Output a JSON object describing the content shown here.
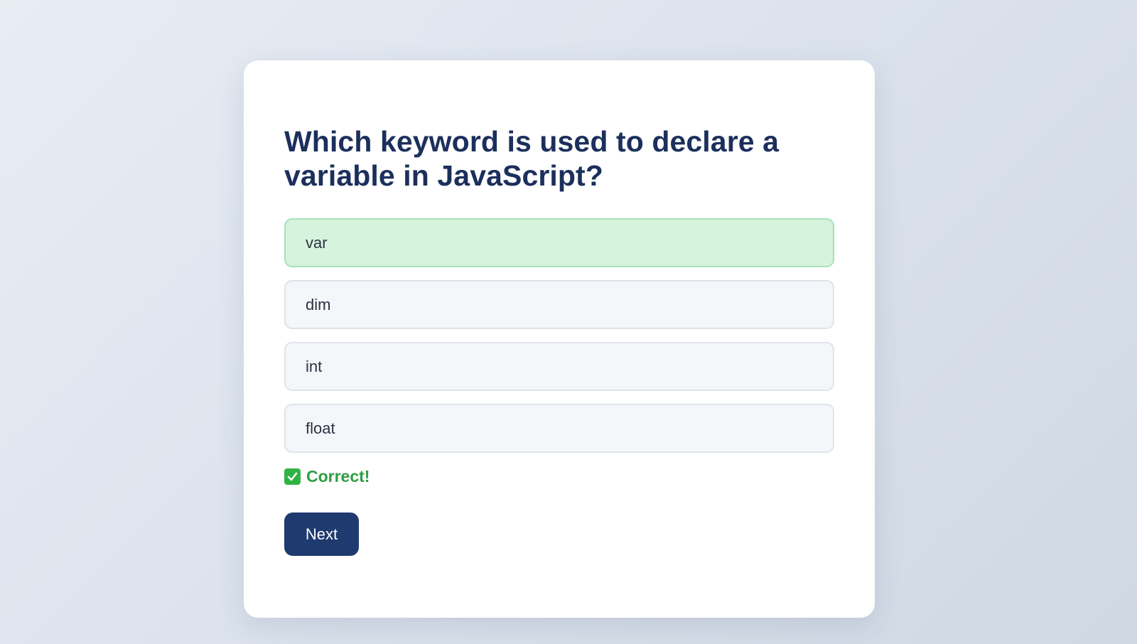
{
  "quiz": {
    "question": "Which keyword is used to declare a variable in JavaScript?",
    "options": [
      {
        "label": "var",
        "state": "correct"
      },
      {
        "label": "dim",
        "state": "default"
      },
      {
        "label": "int",
        "state": "default"
      },
      {
        "label": "float",
        "state": "default"
      }
    ],
    "feedback": {
      "icon": "check-mark-icon",
      "text": "Correct!",
      "color": "#2e9e42"
    },
    "next_label": "Next"
  },
  "colors": {
    "primary": "#1f3a6f",
    "title": "#1c2f5c",
    "correct_bg": "#d6f3dd",
    "correct_border": "#a7e1b4",
    "option_bg": "#f4f6fa"
  }
}
